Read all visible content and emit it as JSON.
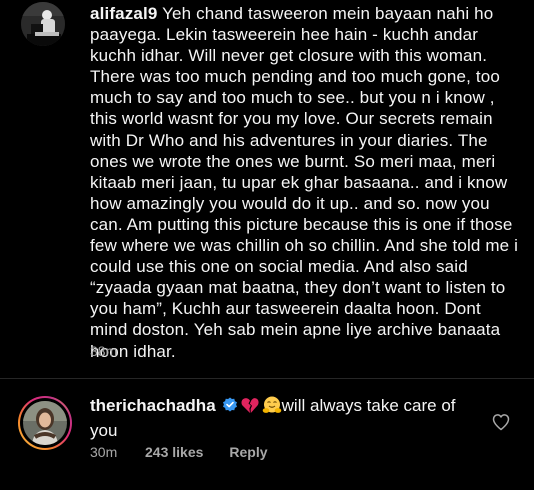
{
  "comment_1": {
    "username": "alifazal9",
    "text": " Yeh chand tasweeron mein bayaan nahi ho paayega. Lekin tasweerein hee hain - kuchh andar kuchh idhar. Will never get closure with this woman. There was too much pending and too much gone, too much to say and too much to see.. but you n i know , this world wasnt for you my love. Our secrets remain with Dr Who and his adventures in your diaries. The ones we wrote the ones we burnt. So meri maa, meri kitaab meri jaan, tu upar ek ghar basaana.. and i know how amazingly you would do it up.. and so. now you can. Am putting this picture because this is one if those few where we was chillin oh so chillin. And she told me i could use this one on social media. And also said “zyaada gyaan mat baatna, they don’t want to listen to you ham”, Kuchh aur tasweerein daalta hoon. Dont mind doston. Yeh sab mein apne liye archive banaata hoon idhar.",
    "time": "38m"
  },
  "comment_2": {
    "username": "therichachadha",
    "text": "will always take care of you",
    "time": "30m",
    "likes": "243 likes",
    "reply_label": "Reply"
  },
  "icons": {
    "verified": "verified-badge-icon",
    "broken_heart": "broken-heart-emoji",
    "hug": "hugging-face-emoji",
    "like": "heart-outline-icon"
  },
  "colors": {
    "background": "#000000",
    "text": "#f5f5f5",
    "secondary_text": "#a8a8a8",
    "verified_blue": "#3897f0",
    "broken_heart_red": "#e0245e",
    "hug_yellow": "#ffcc4d"
  }
}
